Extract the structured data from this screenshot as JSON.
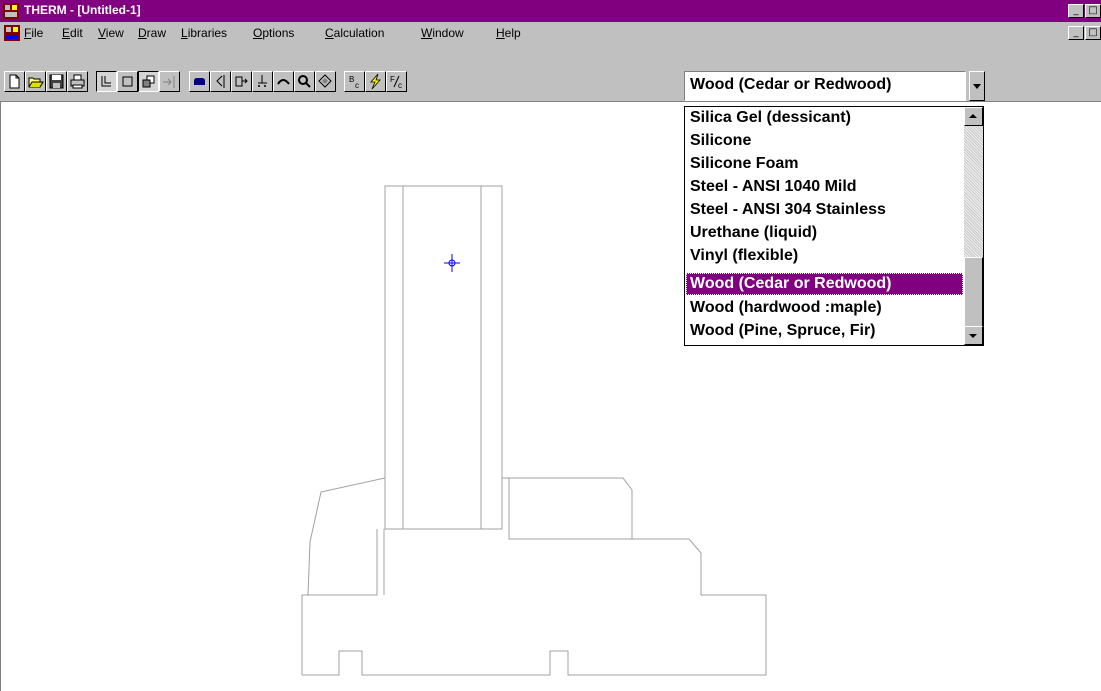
{
  "window": {
    "title": "THERM - [Untitled-1]",
    "min_glyph": "_",
    "restore_glyph": "□",
    "app_icon": "therm-app-icon"
  },
  "menubar": {
    "items": [
      {
        "label": "File",
        "key": "F"
      },
      {
        "label": "Edit",
        "key": "E"
      },
      {
        "label": "View",
        "key": "V"
      },
      {
        "label": "Draw",
        "key": "D"
      },
      {
        "label": "Libraries",
        "key": "L"
      },
      {
        "label": "Options",
        "key": "O"
      },
      {
        "label": "Calculation",
        "key": "C"
      },
      {
        "label": "Window",
        "key": "W"
      },
      {
        "label": "Help",
        "key": "H"
      }
    ],
    "doc_icon": "therm-document-icon",
    "child_min_glyph": "_",
    "child_restore_glyph": "□"
  },
  "toolbar": {
    "buttons": [
      {
        "icon": "new-file-icon",
        "pressed": false
      },
      {
        "icon": "open-folder-icon",
        "pressed": false
      },
      {
        "icon": "save-disk-icon",
        "pressed": false
      },
      {
        "icon": "print-icon",
        "pressed": false
      },
      {
        "icon": "draw-locator-icon",
        "pressed": true
      },
      {
        "icon": "draw-rectangle-icon",
        "pressed": false
      },
      {
        "icon": "fill-void-icon",
        "pressed": true
      },
      {
        "icon": "insert-point-icon",
        "pressed": false
      },
      {
        "icon": "boundary-shape-icon",
        "pressed": false
      },
      {
        "icon": "select-arrow-icon",
        "pressed": false
      },
      {
        "icon": "move-point-icon",
        "pressed": false
      },
      {
        "icon": "draw-point-icon",
        "pressed": false
      },
      {
        "icon": "undo-arc-icon",
        "pressed": false
      },
      {
        "icon": "zoom-magnifier-icon",
        "pressed": false
      },
      {
        "icon": "rotate-diamond-icon",
        "pressed": false
      },
      {
        "icon": "boundary-condition-icon",
        "pressed": false,
        "text": "Bc"
      },
      {
        "icon": "calculate-lightning-icon",
        "pressed": false
      },
      {
        "icon": "temperature-icon",
        "pressed": false,
        "text": "F/c"
      }
    ]
  },
  "material_select": {
    "value": "Wood (Cedar or Redwood)",
    "options": [
      "Silica Gel (dessicant)",
      "Silicone",
      "Silicone Foam",
      "Steel - ANSI 1040 Mild",
      "Steel - ANSI 304 Stainless",
      "Urethane (liquid)",
      "Vinyl (flexible)",
      "Wood (Cedar or Redwood)",
      "Wood (hardwood :maple)",
      "Wood (Pine, Spruce, Fir)"
    ],
    "selected_index": 7
  },
  "colors": {
    "titlebar": "#800080",
    "selection": "#800080",
    "face": "#c0c0c0",
    "geometry_line": "#a0a0a0",
    "locator": "#0000ff",
    "lightning": "#ffff00"
  }
}
